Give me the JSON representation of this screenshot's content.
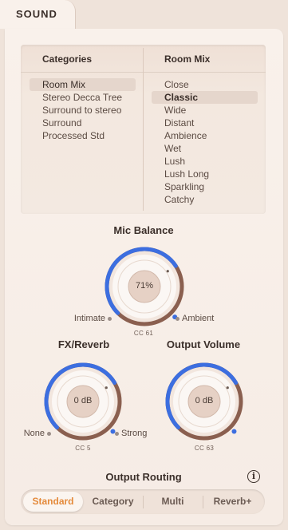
{
  "tab": {
    "label": "SOUND"
  },
  "browser": {
    "categories_header": "Categories",
    "roommix_header": "Room Mix",
    "categories": [
      "Room Mix",
      "Stereo Decca Tree",
      "Surround to stereo",
      "Surround",
      "Processed Std"
    ],
    "categories_selected": "Room Mix",
    "roommix": [
      "Close",
      "Classic",
      "Wide",
      "Distant",
      "Ambience",
      "Wet",
      "Lush",
      "Lush Long",
      "Sparkling",
      "Catchy"
    ],
    "roommix_selected": "Classic"
  },
  "mic_balance": {
    "title": "Mic Balance",
    "value_text": "71%",
    "value": 0.71,
    "left_label": "Intimate",
    "right_label": "Ambient",
    "cc": "CC 61"
  },
  "fx_reverb": {
    "title": "FX/Reverb",
    "value_text": "0 dB",
    "value": 0.72,
    "left_label": "None",
    "right_label": "Strong",
    "cc": "CC 5"
  },
  "output_volume": {
    "title": "Output Volume",
    "value_text": "0 dB",
    "value": 0.72,
    "cc": "CC 63"
  },
  "routing": {
    "title": "Output Routing",
    "options": [
      "Standard",
      "Category",
      "Multi",
      "Reverb+"
    ],
    "selected": "Standard",
    "info_glyph": "i"
  },
  "colors": {
    "accent": "#e48a3b",
    "knob_blue": "#3c6ee0",
    "knob_ring": "#8a5f4f"
  }
}
